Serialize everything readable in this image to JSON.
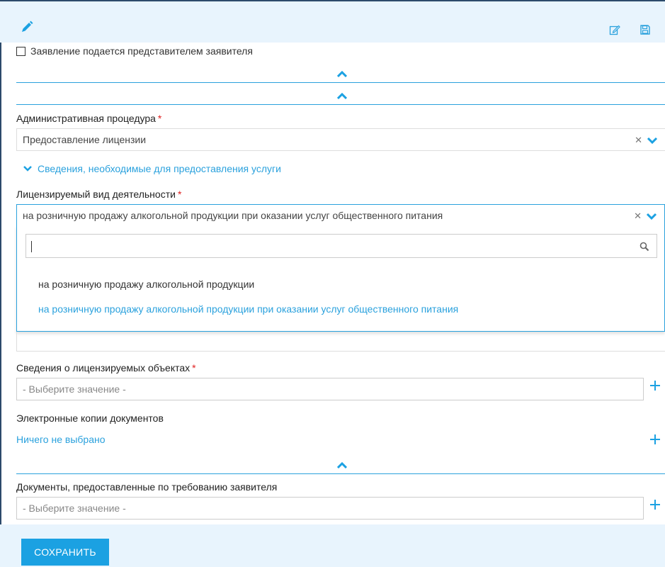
{
  "toolbar": {
    "icons": [
      "pencil-icon",
      "edit-icon",
      "save-icon"
    ]
  },
  "representative": {
    "label": "Заявление подается представителем заявителя",
    "checked": false
  },
  "procedure": {
    "label": "Административная процедура",
    "required_mark": "*",
    "value": "Предоставление лицензии"
  },
  "service_info": {
    "label": "Сведения, необходимые для предоставления услуги"
  },
  "activity": {
    "label": "Лицензируемый вид деятельности",
    "required_mark": "*",
    "value": "на розничную продажу алкогольной продукции при оказании услуг общественного питания",
    "search_value": "",
    "options": [
      "на розничную продажу алкогольной продукции",
      "на розничную продажу алкогольной продукции при оказании услуг общественного питания"
    ]
  },
  "objects": {
    "label": "Сведения о лицензируемых объектах",
    "required_mark": "*",
    "placeholder": "- Выберите значение -"
  },
  "electronic_copies": {
    "label": "Электронные копии документов",
    "value": "Ничего не выбрано"
  },
  "requested_docs": {
    "label": "Документы, предоставленные по требованию заявителя",
    "placeholder": "- Выберите значение -"
  },
  "actions": {
    "save_label": "СОХРАНИТЬ"
  },
  "colors": {
    "accent": "#2aa1dd",
    "button": "#1ba1e2",
    "required": "#e02020",
    "header_bg": "#e8f4fd"
  }
}
